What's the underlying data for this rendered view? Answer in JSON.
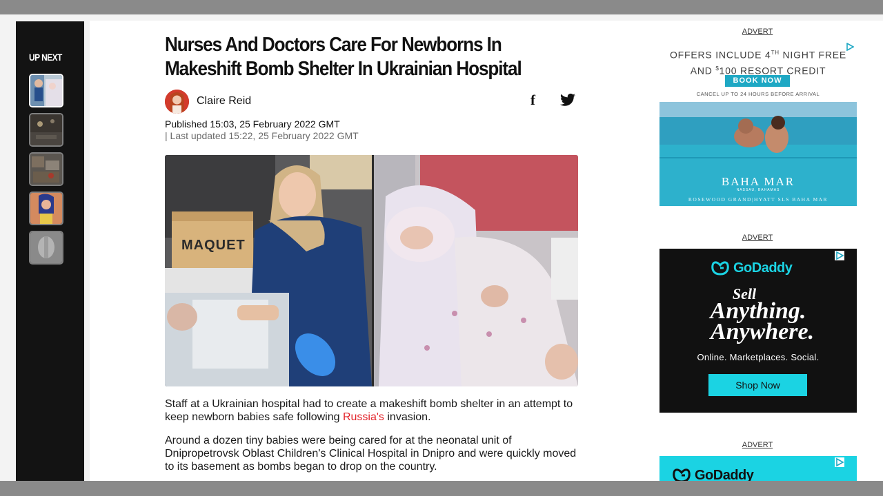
{
  "up_next": {
    "title": "UP NEXT",
    "thumbnails": [
      {
        "name": "thumb-1",
        "active": true
      },
      {
        "name": "thumb-2",
        "active": false
      },
      {
        "name": "thumb-3",
        "active": false
      },
      {
        "name": "thumb-4",
        "active": false
      },
      {
        "name": "thumb-5",
        "active": false
      }
    ]
  },
  "article": {
    "headline": "Nurses And Doctors Care For Newborns In Makeshift Bomb Shelter In Ukrainian Hospital",
    "author": "Claire Reid",
    "published": "Published 15:03, 25 February 2022 GMT",
    "last_updated": "| Last updated 15:22, 25 February 2022 GMT",
    "share": {
      "facebook_icon": "facebook-icon",
      "twitter_icon": "twitter-icon"
    },
    "hero_label": "MAQUET",
    "paragraphs": [
      {
        "before": "Staff at a Ukrainian hospital had to create a makeshift bomb shelter in an attempt to keep newborn babies safe following ",
        "link": "Russia's",
        "after": " invasion."
      },
      {
        "text": "Around a dozen tiny babies were being cared for at the neonatal unit of Dnipropetrovsk Oblast Children's Clinical Hospital in Dnipro and were quickly moved to its basement as bombs began to drop on the country."
      }
    ],
    "link_color": "#e3242b"
  },
  "ads": {
    "label": "ADVERT",
    "ad1": {
      "offer_line1": "OFFERS INCLUDE 4",
      "offer_sup1": "TH",
      "offer_line1_end": " NIGHT FREE",
      "offer_line2_start": "AND ",
      "offer_sup2": "$",
      "offer_line2_end": "100 RESORT CREDIT",
      "cta": "BOOK NOW",
      "cancel": "CANCEL UP TO 24 HOURS BEFORE ARRIVAL",
      "brand": "BAHA MAR",
      "brand_sub": "NASSAU, BAHAMAS",
      "hotels": "ROSEWOOD    GRAND|HYATT    SLS BAHA MAR",
      "accent": "#1ea8c4"
    },
    "ad2": {
      "brand": "GoDaddy",
      "line1": "Sell",
      "line2": "Anything.",
      "line3": "Anywhere.",
      "tagline": "Online. Marketplaces. Social.",
      "cta": "Shop Now",
      "accent": "#1bd3e3"
    },
    "ad3": {
      "brand": "GoDaddy"
    }
  }
}
